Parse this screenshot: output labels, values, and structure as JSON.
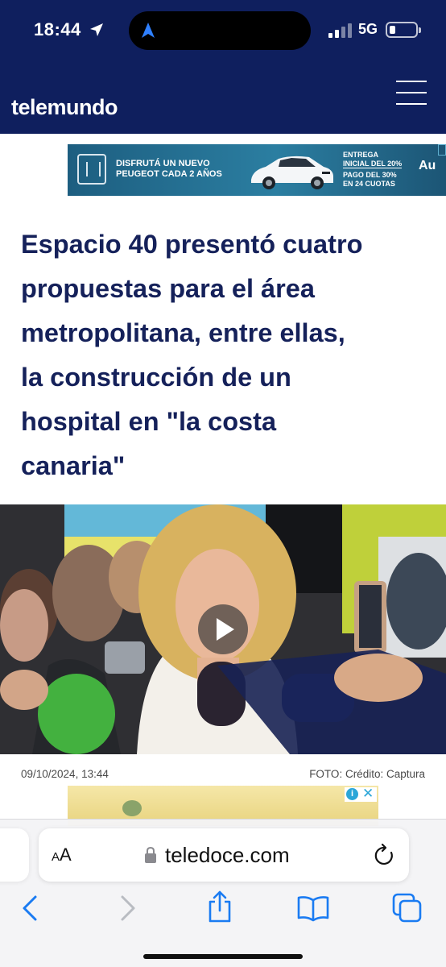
{
  "status_bar": {
    "time": "18:44",
    "network": "5G",
    "location_icon": "location-arrow-icon"
  },
  "site": {
    "brand": "telemundo",
    "menu_icon": "hamburger-menu-icon"
  },
  "ad_banner": {
    "headline_line1": "DISFRUTÁ UN NUEVO",
    "headline_line2": "PEUGEOT CADA 2 AÑOS",
    "offer_line1": "ENTREGA",
    "offer_line2": "INICIAL DEL 20%",
    "offer_line3": "PAGO DEL 30%",
    "offer_line4": "EN 24 CUOTAS",
    "brand_fragment": "Au"
  },
  "article": {
    "headline_lines": [
      "Espacio 40 presentó cuatro",
      "propuestas para el área",
      "metropolitana, entre ellas,",
      "la construcción de un",
      "hospital en \"la costa",
      "canaria\""
    ],
    "date": "09/10/2024, 13:44",
    "photo_credit": "FOTO: Crédito: Captura",
    "media": {
      "type": "video",
      "play_icon": "play-icon"
    }
  },
  "ad_banner_2": {
    "icons": [
      "info-icon",
      "close-icon"
    ]
  },
  "browser": {
    "text_size_label_big": "A",
    "text_size_label_small": "A",
    "url": "teledoce.com",
    "nav_icons": [
      "back-icon",
      "forward-icon",
      "share-icon",
      "bookmarks-icon",
      "tabs-icon"
    ]
  },
  "colors": {
    "header_bg": "#0f1f5e",
    "headline_text": "#15215a",
    "safari_blue": "#1a7bf2"
  }
}
